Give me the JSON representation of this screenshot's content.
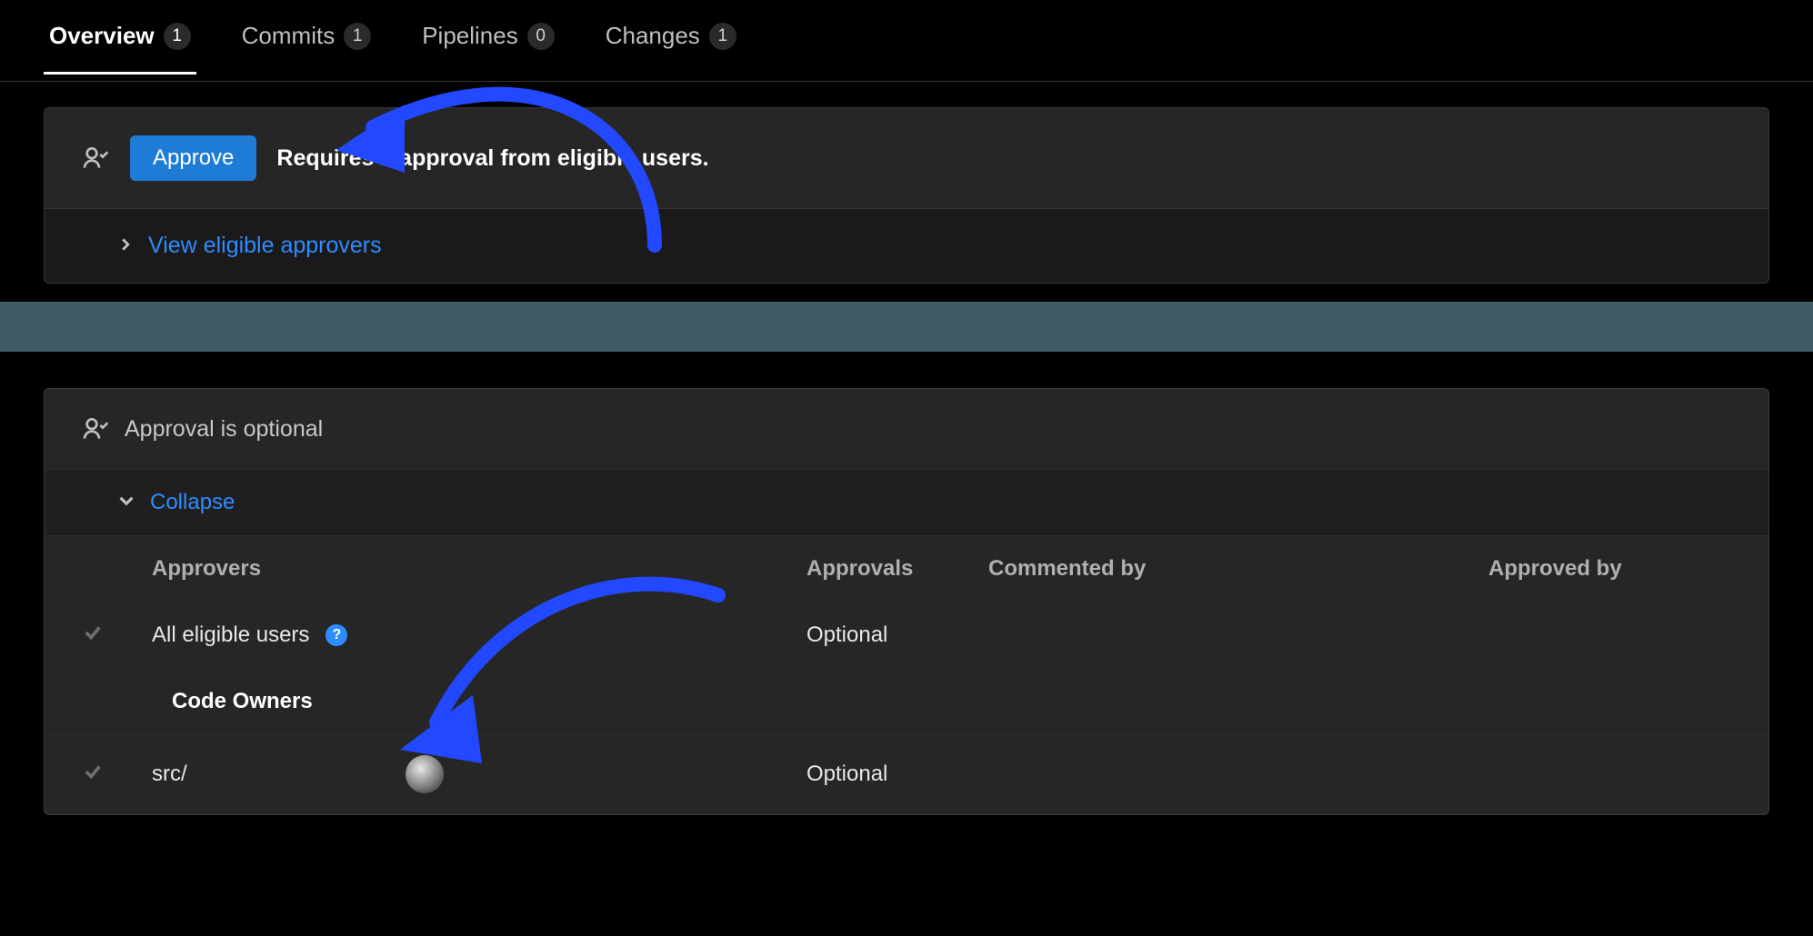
{
  "tabs": [
    {
      "label": "Overview",
      "count": "1",
      "active": true
    },
    {
      "label": "Commits",
      "count": "1",
      "active": false
    },
    {
      "label": "Pipelines",
      "count": "0",
      "active": false
    },
    {
      "label": "Changes",
      "count": "1",
      "active": false
    }
  ],
  "approval": {
    "approve_button": "Approve",
    "requires_text": "Requires 1 approval from eligible users.",
    "view_link": "View eligible approvers"
  },
  "approval2": {
    "status": "Approval is optional",
    "collapse_label": "Collapse",
    "columns": {
      "approvers": "Approvers",
      "approvals": "Approvals",
      "commented_by": "Commented by",
      "approved_by": "Approved by"
    },
    "rows": {
      "all_eligible": {
        "label": "All eligible users",
        "approvals": "Optional"
      },
      "section": {
        "label": "Code Owners"
      },
      "src": {
        "label": "src/",
        "approvals": "Optional"
      }
    }
  }
}
